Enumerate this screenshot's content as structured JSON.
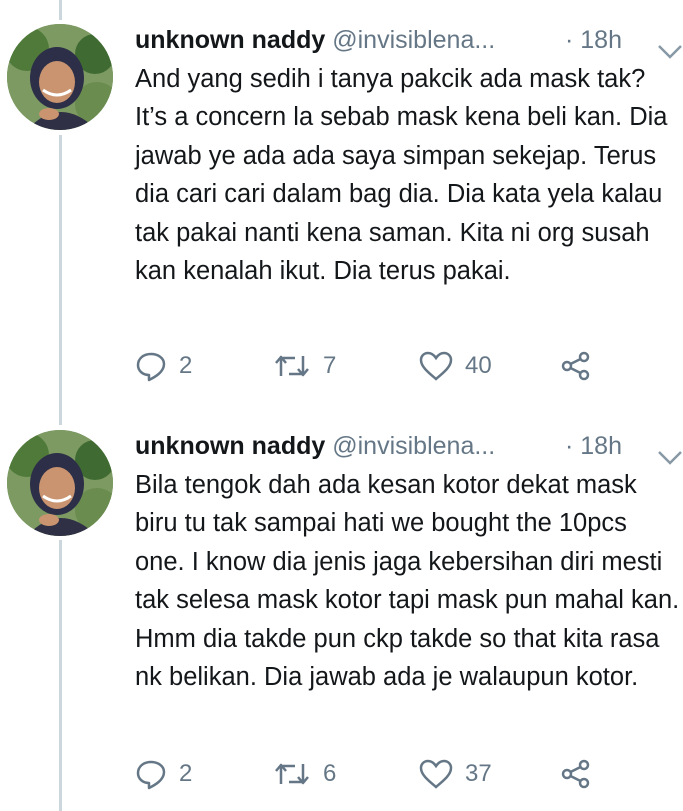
{
  "tweets": [
    {
      "name": "unknown naddy",
      "handle": "@invisiblena...",
      "time": "· 18h",
      "text": "And yang sedih i tanya pakcik ada mask tak? It’s a concern la sebab mask kena beli kan. Dia jawab ye ada ada saya simpan sekejap. Terus dia cari cari dalam bag dia. Dia kata yela kalau tak pakai nanti kena saman. Kita ni org susah kan kenalah ikut. Dia terus pakai.",
      "replies": "2",
      "retweets": "7",
      "likes": "40"
    },
    {
      "name": "unknown naddy",
      "handle": "@invisiblena...",
      "time": "· 18h",
      "text": "Bila tengok dah ada kesan kotor dekat mask biru tu tak sampai hati we bought the 10pcs one. I know dia jenis jaga kebersihan diri mesti tak selesa mask kotor tapi mask pun mahal kan. Hmm dia takde pun ckp takde so that kita rasa nk belikan. Dia jawab ada je walaupun kotor.",
      "replies": "2",
      "retweets": "6",
      "likes": "37"
    }
  ],
  "colors": {
    "text": "#14171a",
    "muted": "#657786",
    "thread": "#ccd6dd"
  },
  "icons": [
    "reply-icon",
    "retweet-icon",
    "like-icon",
    "share-icon",
    "chevron-down-icon"
  ]
}
